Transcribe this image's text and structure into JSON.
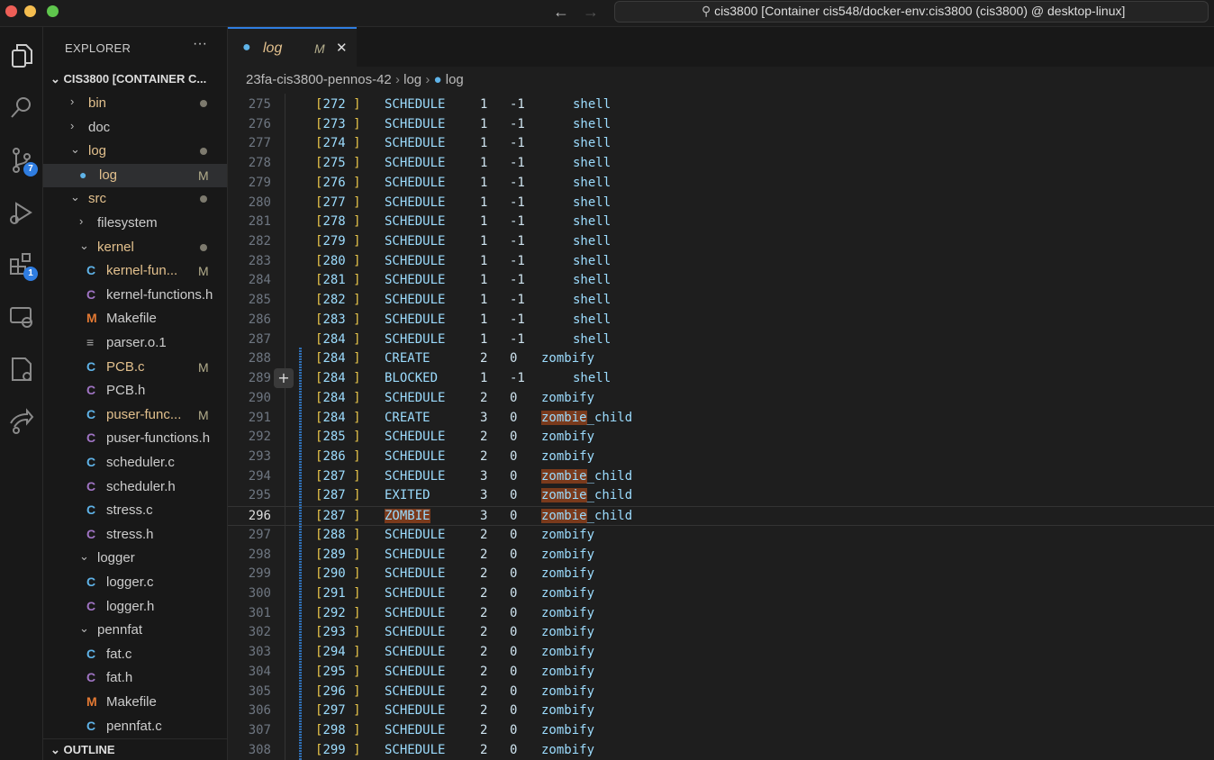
{
  "window": {
    "command_center": "cis3800 [Container cis548/docker-env:cis3800 (cis3800) @ desktop-linux]"
  },
  "activity_bar": {
    "source_control_badge": "7",
    "extensions_badge": "1"
  },
  "sidebar": {
    "title": "EXPLORER",
    "more": "···",
    "root": "CIS3800 [CONTAINER C...",
    "items": [
      {
        "label": "bin",
        "depth": 1,
        "type": "folder",
        "open": false,
        "dot": true,
        "color": "#e2c08d"
      },
      {
        "label": "doc",
        "depth": 1,
        "type": "folder",
        "open": false,
        "color": "#cccccc"
      },
      {
        "label": "log",
        "depth": 1,
        "type": "folder",
        "open": true,
        "dot": true,
        "color": "#e2c08d"
      },
      {
        "label": "log",
        "depth": 2,
        "type": "log",
        "badge": "M",
        "selected": true,
        "color": "#e2c08d"
      },
      {
        "label": "src",
        "depth": 1,
        "type": "folder",
        "open": true,
        "dot": true,
        "color": "#e2c08d"
      },
      {
        "label": "filesystem",
        "depth": 2,
        "type": "folder",
        "open": false,
        "color": "#cccccc"
      },
      {
        "label": "kernel",
        "depth": 2,
        "type": "folder",
        "open": true,
        "dot": true,
        "color": "#e2c08d"
      },
      {
        "label": "kernel-fun...",
        "depth": 3,
        "type": "c",
        "badge": "M",
        "color": "#e2c08d"
      },
      {
        "label": "kernel-functions.h",
        "depth": 3,
        "type": "h",
        "color": "#cccccc"
      },
      {
        "label": "Makefile",
        "depth": 3,
        "type": "make",
        "color": "#cccccc"
      },
      {
        "label": "parser.o.1",
        "depth": 3,
        "type": "text",
        "color": "#cccccc"
      },
      {
        "label": "PCB.c",
        "depth": 3,
        "type": "c",
        "badge": "M",
        "color": "#e2c08d"
      },
      {
        "label": "PCB.h",
        "depth": 3,
        "type": "h",
        "color": "#cccccc"
      },
      {
        "label": "puser-func...",
        "depth": 3,
        "type": "c",
        "badge": "M",
        "color": "#e2c08d"
      },
      {
        "label": "puser-functions.h",
        "depth": 3,
        "type": "h",
        "color": "#cccccc"
      },
      {
        "label": "scheduler.c",
        "depth": 3,
        "type": "c",
        "color": "#cccccc"
      },
      {
        "label": "scheduler.h",
        "depth": 3,
        "type": "h",
        "color": "#cccccc"
      },
      {
        "label": "stress.c",
        "depth": 3,
        "type": "c",
        "color": "#cccccc"
      },
      {
        "label": "stress.h",
        "depth": 3,
        "type": "h",
        "color": "#cccccc"
      },
      {
        "label": "logger",
        "depth": 2,
        "type": "folder",
        "open": true,
        "color": "#cccccc"
      },
      {
        "label": "logger.c",
        "depth": 3,
        "type": "c",
        "color": "#cccccc"
      },
      {
        "label": "logger.h",
        "depth": 3,
        "type": "h",
        "color": "#cccccc"
      },
      {
        "label": "pennfat",
        "depth": 2,
        "type": "folder",
        "open": true,
        "color": "#cccccc"
      },
      {
        "label": "fat.c",
        "depth": 3,
        "type": "c",
        "color": "#cccccc"
      },
      {
        "label": "fat.h",
        "depth": 3,
        "type": "h",
        "color": "#cccccc"
      },
      {
        "label": "Makefile",
        "depth": 3,
        "type": "make",
        "color": "#cccccc"
      },
      {
        "label": "pennfat.c",
        "depth": 3,
        "type": "c",
        "color": "#cccccc"
      }
    ],
    "outline": "OUTLINE"
  },
  "tab": {
    "label": "log",
    "status": "M",
    "close": "✕"
  },
  "breadcrumb": [
    "23fa-cis3800-pennos-42",
    "log",
    "log"
  ],
  "editor": {
    "current_line": 296,
    "highlight_word": "zombie",
    "lines": [
      [
        275,
        "272",
        "SCHEDULE",
        "1",
        "-1",
        "shell"
      ],
      [
        276,
        "273",
        "SCHEDULE",
        "1",
        "-1",
        "shell"
      ],
      [
        277,
        "274",
        "SCHEDULE",
        "1",
        "-1",
        "shell"
      ],
      [
        278,
        "275",
        "SCHEDULE",
        "1",
        "-1",
        "shell"
      ],
      [
        279,
        "276",
        "SCHEDULE",
        "1",
        "-1",
        "shell"
      ],
      [
        280,
        "277",
        "SCHEDULE",
        "1",
        "-1",
        "shell"
      ],
      [
        281,
        "278",
        "SCHEDULE",
        "1",
        "-1",
        "shell"
      ],
      [
        282,
        "279",
        "SCHEDULE",
        "1",
        "-1",
        "shell"
      ],
      [
        283,
        "280",
        "SCHEDULE",
        "1",
        "-1",
        "shell"
      ],
      [
        284,
        "281",
        "SCHEDULE",
        "1",
        "-1",
        "shell"
      ],
      [
        285,
        "282",
        "SCHEDULE",
        "1",
        "-1",
        "shell"
      ],
      [
        286,
        "283",
        "SCHEDULE",
        "1",
        "-1",
        "shell"
      ],
      [
        287,
        "284",
        "SCHEDULE",
        "1",
        "-1",
        "shell"
      ],
      [
        288,
        "284",
        "CREATE",
        "2",
        "0",
        "zombify"
      ],
      [
        289,
        "284",
        "BLOCKED",
        "1",
        "-1",
        "shell"
      ],
      [
        290,
        "284",
        "SCHEDULE",
        "2",
        "0",
        "zombify"
      ],
      [
        291,
        "284",
        "CREATE",
        "3",
        "0",
        "zombie_child"
      ],
      [
        292,
        "285",
        "SCHEDULE",
        "2",
        "0",
        "zombify"
      ],
      [
        293,
        "286",
        "SCHEDULE",
        "2",
        "0",
        "zombify"
      ],
      [
        294,
        "287",
        "SCHEDULE",
        "3",
        "0",
        "zombie_child"
      ],
      [
        295,
        "287",
        "EXITED",
        "3",
        "0",
        "zombie_child"
      ],
      [
        296,
        "287",
        "ZOMBIE",
        "3",
        "0",
        "zombie_child"
      ],
      [
        297,
        "288",
        "SCHEDULE",
        "2",
        "0",
        "zombify"
      ],
      [
        298,
        "289",
        "SCHEDULE",
        "2",
        "0",
        "zombify"
      ],
      [
        299,
        "290",
        "SCHEDULE",
        "2",
        "0",
        "zombify"
      ],
      [
        300,
        "291",
        "SCHEDULE",
        "2",
        "0",
        "zombify"
      ],
      [
        301,
        "292",
        "SCHEDULE",
        "2",
        "0",
        "zombify"
      ],
      [
        302,
        "293",
        "SCHEDULE",
        "2",
        "0",
        "zombify"
      ],
      [
        303,
        "294",
        "SCHEDULE",
        "2",
        "0",
        "zombify"
      ],
      [
        304,
        "295",
        "SCHEDULE",
        "2",
        "0",
        "zombify"
      ],
      [
        305,
        "296",
        "SCHEDULE",
        "2",
        "0",
        "zombify"
      ],
      [
        306,
        "297",
        "SCHEDULE",
        "2",
        "0",
        "zombify"
      ],
      [
        307,
        "298",
        "SCHEDULE",
        "2",
        "0",
        "zombify"
      ],
      [
        308,
        "299",
        "SCHEDULE",
        "2",
        "0",
        "zombify"
      ]
    ]
  }
}
